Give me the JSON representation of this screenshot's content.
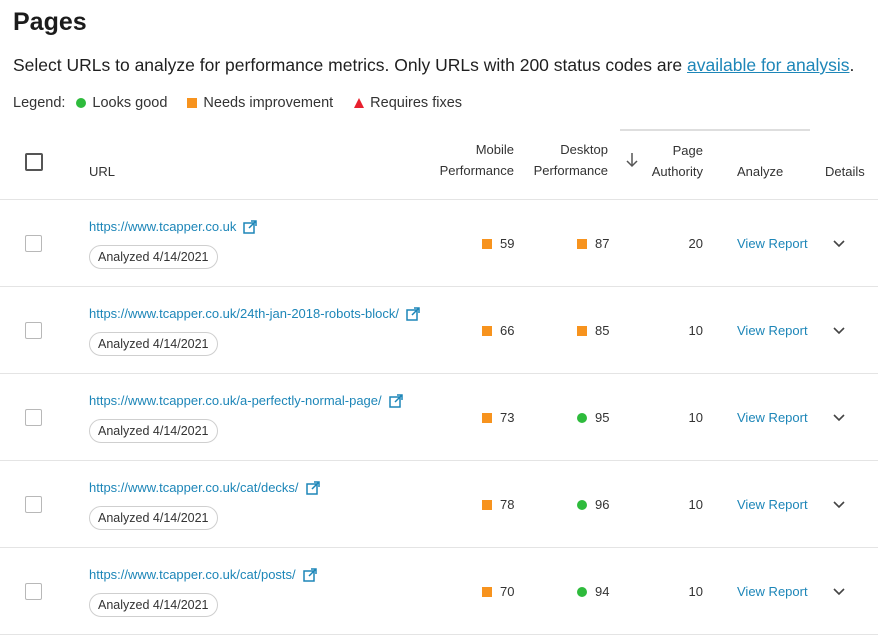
{
  "page": {
    "title": "Pages",
    "description_prefix": "Select URLs to analyze for performance metrics. Only URLs with 200 status codes are ",
    "description_link": "available for analysis",
    "description_suffix": "."
  },
  "legend": {
    "label": "Legend:",
    "good": "Looks good",
    "needs": "Needs improvement",
    "fixes": "Requires fixes"
  },
  "colors": {
    "good": "#2ebb3c",
    "needs": "#f7931e",
    "fixes": "#e8202f",
    "link": "#1d86b8"
  },
  "table": {
    "headers": {
      "url": "URL",
      "mobile_1": "Mobile",
      "mobile_2": "Performance",
      "desktop_1": "Desktop",
      "desktop_2": "Performance",
      "pa_1": "Page",
      "pa_2": "Authority",
      "analyze": "Analyze",
      "details": "Details"
    },
    "rows": [
      {
        "url": "https://www.tcapper.co.uk",
        "badge": "Analyzed 4/14/2021",
        "mobile": "59",
        "mobile_status": "needs",
        "desktop": "87",
        "desktop_status": "needs",
        "pa": "20",
        "report": "View Report"
      },
      {
        "url": "https://www.tcapper.co.uk/24th-jan-2018-robots-block/",
        "badge": "Analyzed 4/14/2021",
        "mobile": "66",
        "mobile_status": "needs",
        "desktop": "85",
        "desktop_status": "needs",
        "pa": "10",
        "report": "View Report"
      },
      {
        "url": "https://www.tcapper.co.uk/a-perfectly-normal-page/",
        "badge": "Analyzed 4/14/2021",
        "mobile": "73",
        "mobile_status": "needs",
        "desktop": "95",
        "desktop_status": "good",
        "pa": "10",
        "report": "View Report"
      },
      {
        "url": "https://www.tcapper.co.uk/cat/decks/",
        "badge": "Analyzed 4/14/2021",
        "mobile": "78",
        "mobile_status": "needs",
        "desktop": "96",
        "desktop_status": "good",
        "pa": "10",
        "report": "View Report"
      },
      {
        "url": "https://www.tcapper.co.uk/cat/posts/",
        "badge": "Analyzed 4/14/2021",
        "mobile": "70",
        "mobile_status": "needs",
        "desktop": "94",
        "desktop_status": "good",
        "pa": "10",
        "report": "View Report"
      }
    ]
  }
}
